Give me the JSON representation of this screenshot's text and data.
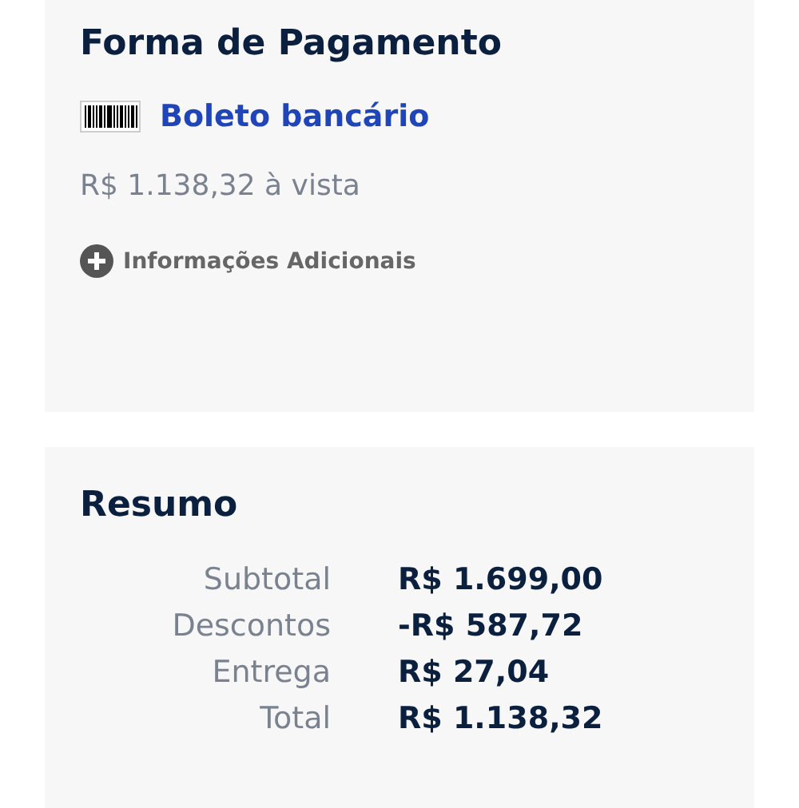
{
  "payment": {
    "title": "Forma de Pagamento",
    "method": "Boleto bancário",
    "price": "R$ 1.138,32 à vista",
    "more_info": "Informações Adicionais"
  },
  "summary": {
    "title": "Resumo",
    "rows": [
      {
        "label": "Subtotal",
        "value": "R$ 1.699,00"
      },
      {
        "label": "Descontos",
        "value": "-R$ 587,72"
      },
      {
        "label": "Entrega",
        "value": "R$ 27,04"
      },
      {
        "label": "Total",
        "value": "R$ 1.138,32"
      }
    ]
  }
}
